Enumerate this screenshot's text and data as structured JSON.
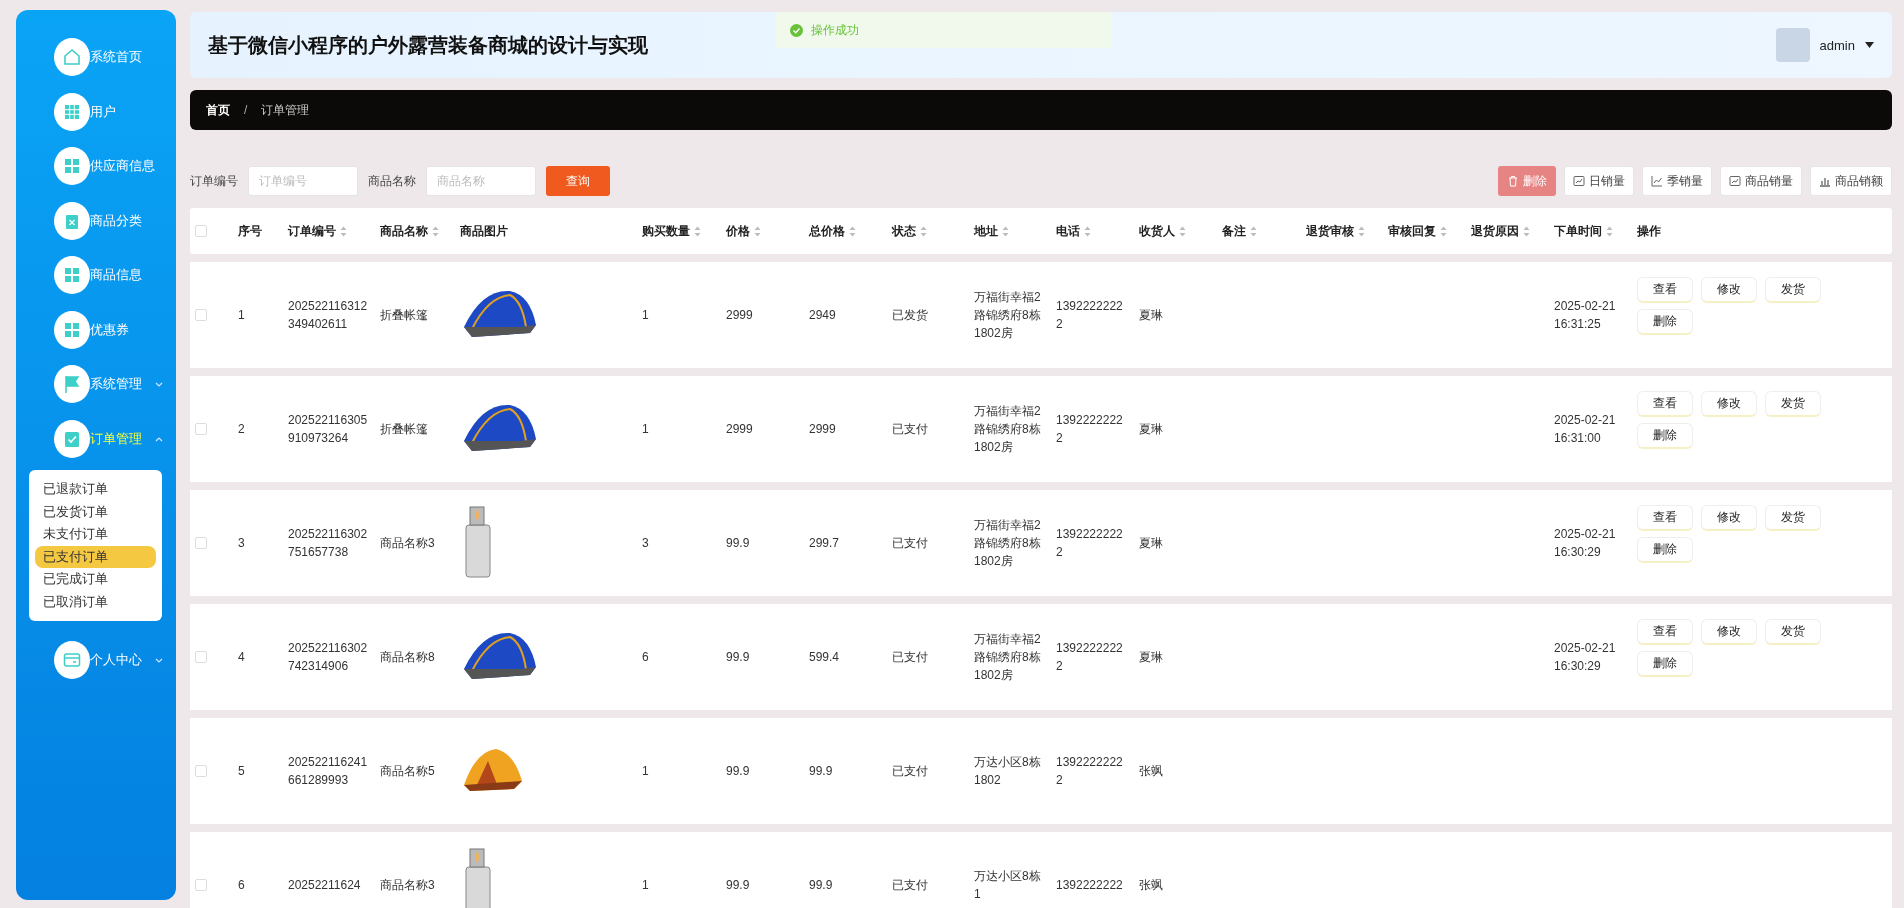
{
  "sidebar": {
    "items": [
      {
        "label": "系统首页",
        "kind": "home",
        "selected": false
      },
      {
        "label": "用户",
        "kind": "grid",
        "selected": false
      },
      {
        "label": "供应商信息",
        "kind": "tiles",
        "selected": false
      },
      {
        "label": "商品分类",
        "kind": "trash",
        "selected": false
      },
      {
        "label": "商品信息",
        "kind": "tiles",
        "selected": false
      },
      {
        "label": "优惠券",
        "kind": "tiles",
        "selected": false
      },
      {
        "label": "系统管理",
        "kind": "flag",
        "selected": false,
        "expanded": false
      },
      {
        "label": "订单管理",
        "kind": "check",
        "selected": true,
        "expanded": true,
        "children": [
          {
            "label": "已退款订单",
            "selected": false
          },
          {
            "label": "已发货订单",
            "selected": false
          },
          {
            "label": "未支付订单",
            "selected": false
          },
          {
            "label": "已支付订单",
            "selected": true
          },
          {
            "label": "已完成订单",
            "selected": false
          },
          {
            "label": "已取消订单",
            "selected": false
          }
        ]
      },
      {
        "label": "个人中心",
        "kind": "card",
        "selected": false,
        "expanded": false
      }
    ]
  },
  "header": {
    "title": "基于微信小程序的户外露营装备商城的设计与实现",
    "user": "admin"
  },
  "toast": {
    "message": "操作成功"
  },
  "breadcrumb": {
    "items": [
      "首页",
      "订单管理"
    ],
    "separator": "/"
  },
  "filters": [
    {
      "label": "订单编号",
      "placeholder": "订单编号"
    },
    {
      "label": "商品名称",
      "placeholder": "商品名称"
    }
  ],
  "search_button": "查询",
  "toolbar": [
    {
      "label": "删除",
      "kind": "delete",
      "disabled": true
    },
    {
      "label": "日销量",
      "kind": "chart"
    },
    {
      "label": "季销量",
      "kind": "line"
    },
    {
      "label": "商品销量",
      "kind": "chart"
    },
    {
      "label": "商品销额",
      "kind": "bars"
    }
  ],
  "table": {
    "select_all": {
      "checked": false
    },
    "columns": [
      {
        "label": "序号",
        "sortable": false
      },
      {
        "label": "订单编号",
        "sortable": true
      },
      {
        "label": "商品名称",
        "sortable": true
      },
      {
        "label": "商品图片",
        "sortable": false
      },
      {
        "label": "购买数量",
        "sortable": true
      },
      {
        "label": "价格",
        "sortable": true
      },
      {
        "label": "总价格",
        "sortable": true
      },
      {
        "label": "状态",
        "sortable": true
      },
      {
        "label": "地址",
        "sortable": true
      },
      {
        "label": "电话",
        "sortable": true
      },
      {
        "label": "收货人",
        "sortable": true
      },
      {
        "label": "备注",
        "sortable": true
      },
      {
        "label": "退货审核",
        "sortable": true
      },
      {
        "label": "审核回复",
        "sortable": true
      },
      {
        "label": "退货原因",
        "sortable": true
      },
      {
        "label": "下单时间",
        "sortable": true
      },
      {
        "label": "操作",
        "sortable": false
      }
    ],
    "rows": [
      {
        "checked": false,
        "no": "1",
        "order_no": "202522116312349402611",
        "product": "折叠帐篷",
        "kind": "tent-blue",
        "qty": "1",
        "price": "2999",
        "total": "2949",
        "status": "已发货",
        "address": "万福街幸福2路锦绣府8栋1802房",
        "phone": "13922222222",
        "receiver": "夏琳",
        "time": "2025-02-21 16:31:25",
        "actions": [
          "查看",
          "修改",
          "发货",
          "删除"
        ]
      },
      {
        "checked": false,
        "no": "2",
        "order_no": "202522116305910973264",
        "product": "折叠帐篷",
        "kind": "tent-blue",
        "qty": "1",
        "price": "2999",
        "total": "2999",
        "status": "已支付",
        "address": "万福街幸福2路锦绣府8栋1802房",
        "phone": "13922222222",
        "receiver": "夏琳",
        "time": "2025-02-21 16:31:00",
        "actions": [
          "查看",
          "修改",
          "发货",
          "删除"
        ]
      },
      {
        "checked": false,
        "no": "3",
        "order_no": "202522116302751657738",
        "product": "商品名称3",
        "kind": "lighter",
        "qty": "3",
        "price": "99.9",
        "total": "299.7",
        "status": "已支付",
        "address": "万福街幸福2路锦绣府8栋1802房",
        "phone": "13922222222",
        "receiver": "夏琳",
        "time": "2025-02-21 16:30:29",
        "actions": [
          "查看",
          "修改",
          "发货",
          "删除"
        ]
      },
      {
        "checked": false,
        "no": "4",
        "order_no": "202522116302742314906",
        "product": "商品名称8",
        "kind": "tent-blue",
        "qty": "6",
        "price": "99.9",
        "total": "599.4",
        "status": "已支付",
        "address": "万福街幸福2路锦绣府8栋1802房",
        "phone": "13922222222",
        "receiver": "夏琳",
        "time": "2025-02-21 16:30:29",
        "actions": [
          "查看",
          "修改",
          "发货",
          "删除"
        ]
      },
      {
        "checked": false,
        "no": "5",
        "order_no": "202522116241661289993",
        "product": "商品名称5",
        "kind": "tent-orange",
        "qty": "1",
        "price": "99.9",
        "total": "99.9",
        "status": "已支付",
        "address": "万达小区8栋1802",
        "phone": "13922222222",
        "receiver": "张飒"
      },
      {
        "checked": false,
        "no": "6",
        "order_no": "20252211624",
        "product": "商品名称3",
        "kind": "lighter",
        "qty": "1",
        "price": "99.9",
        "total": "99.9",
        "status": "已支付",
        "address": "万达小区8栋1",
        "phone": "1392222222",
        "receiver": "张飒"
      }
    ]
  }
}
